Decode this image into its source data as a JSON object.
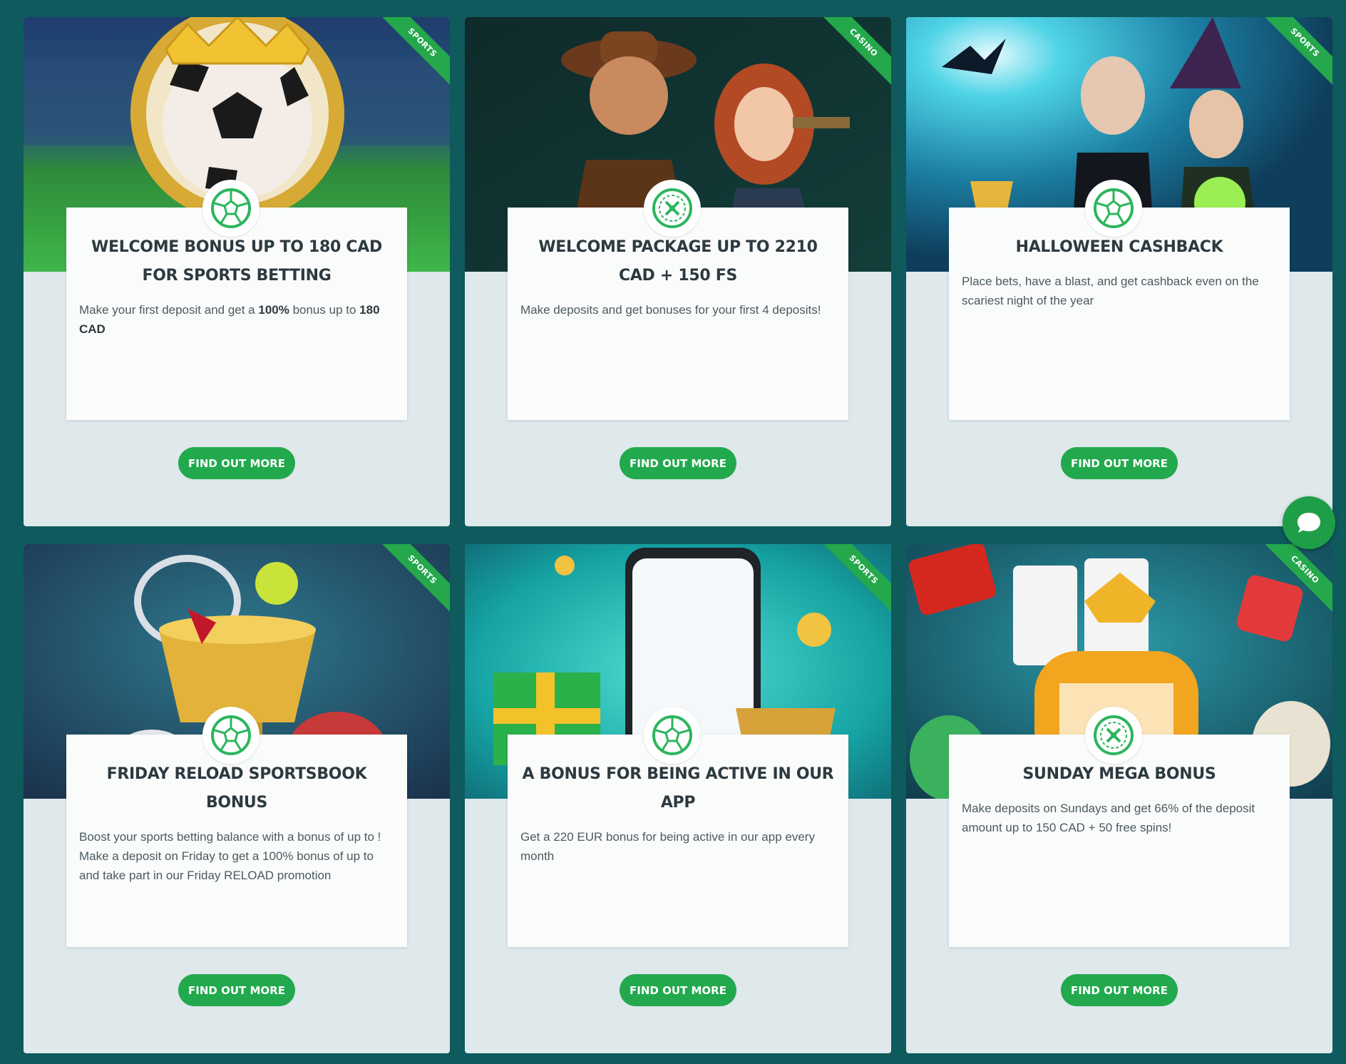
{
  "colors": {
    "background": "#0f5a5c",
    "card": "#dfe8eb",
    "accent": "#22a94e",
    "title": "#2d3a3f"
  },
  "promotions": [
    {
      "tag": "Sports",
      "icon": "soccer-ball-icon",
      "title": "Welcome bonus up to 180 CAD for sports betting",
      "desc_pre": "Make your first deposit and get a ",
      "desc_b1": "100%",
      "desc_mid": " bonus up to ",
      "desc_b2": "180 CAD",
      "desc_post": "",
      "cta": "Find out more"
    },
    {
      "tag": "Casino",
      "icon": "roulette-wheel-icon",
      "title": "Welcome package up to 2210 CAD + 150 FS",
      "desc": "Make deposits and get bonuses for your first 4 deposits!",
      "cta": "Find out more"
    },
    {
      "tag": "Sports",
      "icon": "soccer-ball-icon",
      "title": "Halloween cashback",
      "desc": "Place bets, have a blast, and get cashback even on the scariest night of the year",
      "cta": "Find out more"
    },
    {
      "tag": "Sports",
      "icon": "soccer-ball-icon",
      "title": "Friday reload sportsbook bonus",
      "desc": "Boost your sports betting balance with a bonus of up to ! Make a deposit on Friday to get a 100% bonus of up to and take part in our Friday RELOAD promotion",
      "cta": "Find out more"
    },
    {
      "tag": "Sports",
      "icon": "soccer-ball-icon",
      "title": "A bonus for being active in our app",
      "desc": "Get a 220 EUR bonus for being active in our app every month",
      "cta": "Find out more"
    },
    {
      "tag": "Casino",
      "icon": "roulette-wheel-icon",
      "title": "Sunday mega bonus",
      "desc": "Make deposits on Sundays and get 66% of the deposit amount up to 150 CAD + 50 free spins!",
      "cta": "Find out more"
    }
  ],
  "chat": {
    "icon": "chat-bubble-icon"
  }
}
